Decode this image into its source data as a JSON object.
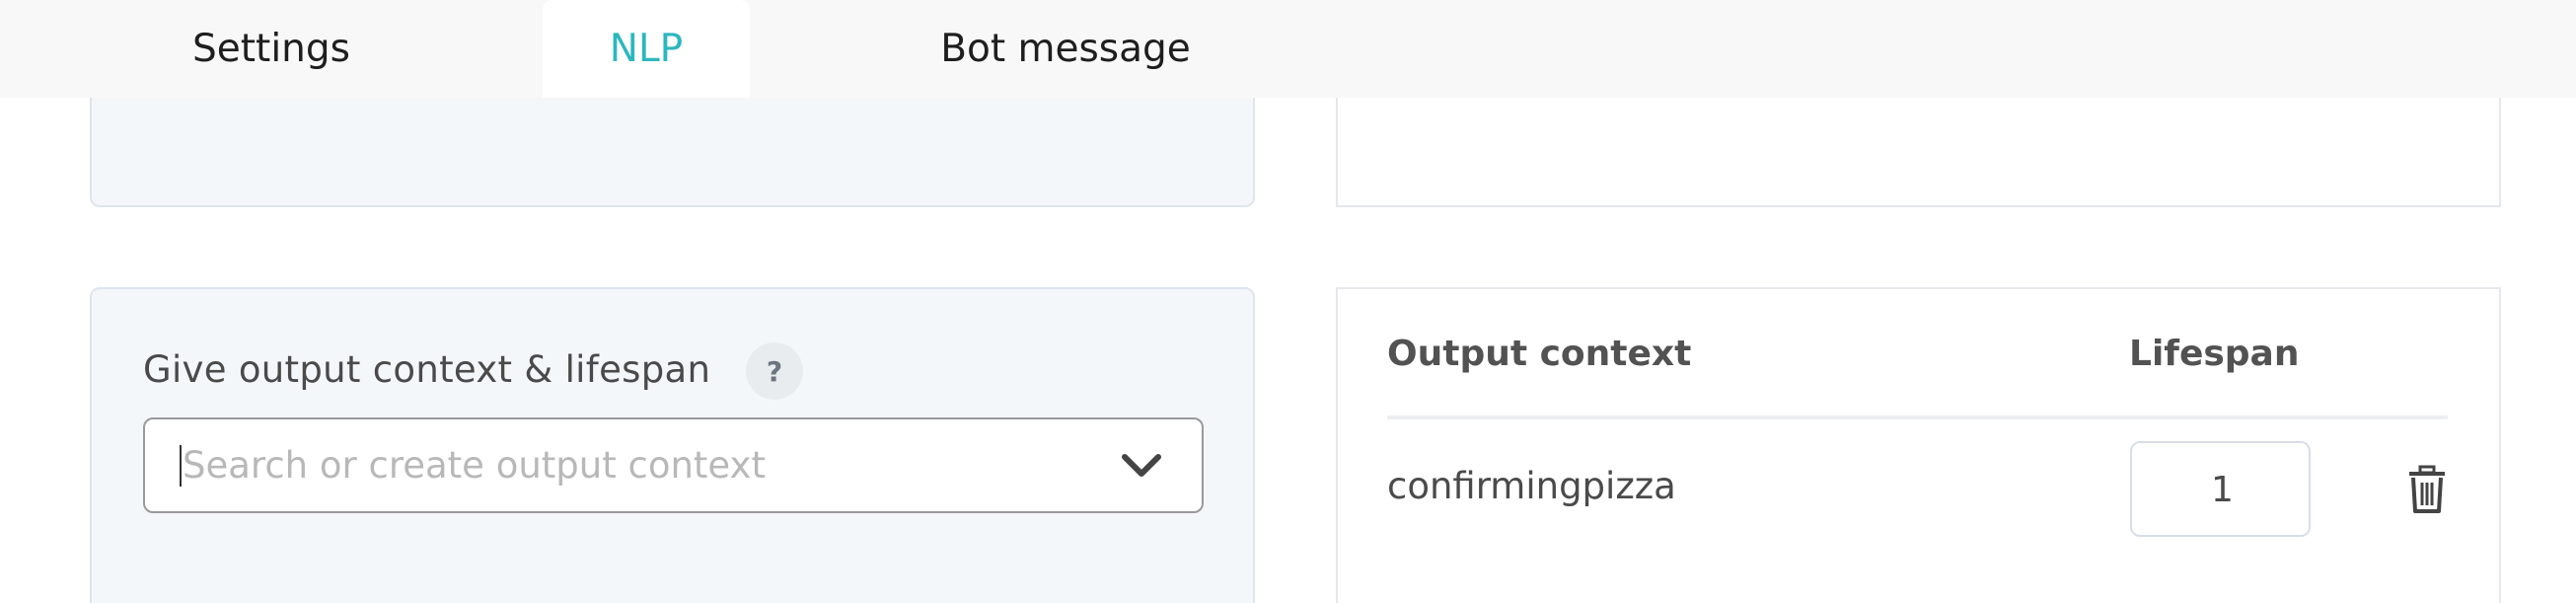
{
  "tabs": [
    {
      "label": "Settings",
      "active": false
    },
    {
      "label": "NLP",
      "active": true
    },
    {
      "label": "Bot message",
      "active": false
    }
  ],
  "colors": {
    "accent": "#2cb7be",
    "panel_bg": "#f4f7fa",
    "tabbar_bg": "#f8f8f8"
  },
  "output_context_form": {
    "label": "Give output context & lifespan",
    "help_icon": "?",
    "search_placeholder": "Search or create output context",
    "search_value": "",
    "dropdown_icon": "chevron-down-icon"
  },
  "output_table": {
    "headers": {
      "context": "Output context",
      "lifespan": "Lifespan"
    },
    "rows": [
      {
        "context": "confirmingpizza",
        "lifespan": "1",
        "delete_icon": "trash-icon"
      }
    ]
  }
}
